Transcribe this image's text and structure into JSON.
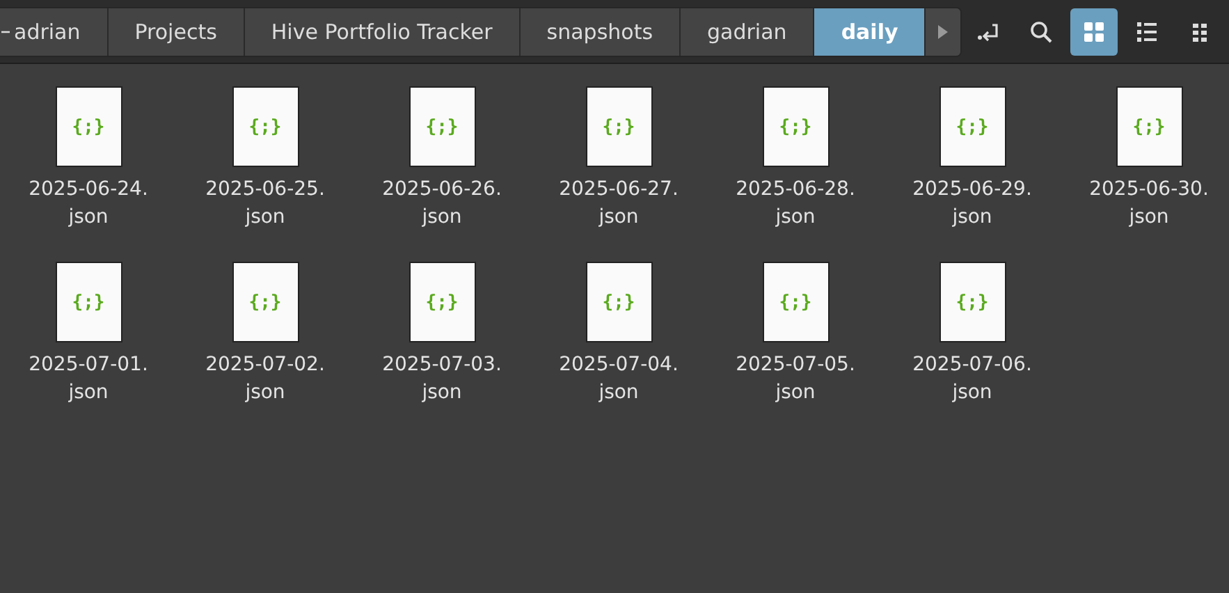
{
  "breadcrumbs": [
    {
      "label": "adrian",
      "selected": false
    },
    {
      "label": "Projects",
      "selected": false
    },
    {
      "label": "Hive Portfolio Tracker",
      "selected": false
    },
    {
      "label": "snapshots",
      "selected": false
    },
    {
      "label": "gadrian",
      "selected": false
    },
    {
      "label": "daily",
      "selected": true
    }
  ],
  "view_buttons": [
    {
      "kind": "grid",
      "selected": true
    },
    {
      "kind": "list",
      "selected": false
    },
    {
      "kind": "compact",
      "selected": false
    }
  ],
  "files": [
    {
      "name": "2025-06-24.json",
      "glyph": "{;}"
    },
    {
      "name": "2025-06-25.json",
      "glyph": "{;}"
    },
    {
      "name": "2025-06-26.json",
      "glyph": "{;}"
    },
    {
      "name": "2025-06-27.json",
      "glyph": "{;}"
    },
    {
      "name": "2025-06-28.json",
      "glyph": "{;}"
    },
    {
      "name": "2025-06-29.json",
      "glyph": "{;}"
    },
    {
      "name": "2025-06-30.json",
      "glyph": "{;}"
    },
    {
      "name": "2025-07-01.json",
      "glyph": "{;}"
    },
    {
      "name": "2025-07-02.json",
      "glyph": "{;}"
    },
    {
      "name": "2025-07-03.json",
      "glyph": "{;}"
    },
    {
      "name": "2025-07-04.json",
      "glyph": "{;}"
    },
    {
      "name": "2025-07-05.json",
      "glyph": "{;}"
    },
    {
      "name": "2025-07-06.json",
      "glyph": "{;}"
    }
  ]
}
